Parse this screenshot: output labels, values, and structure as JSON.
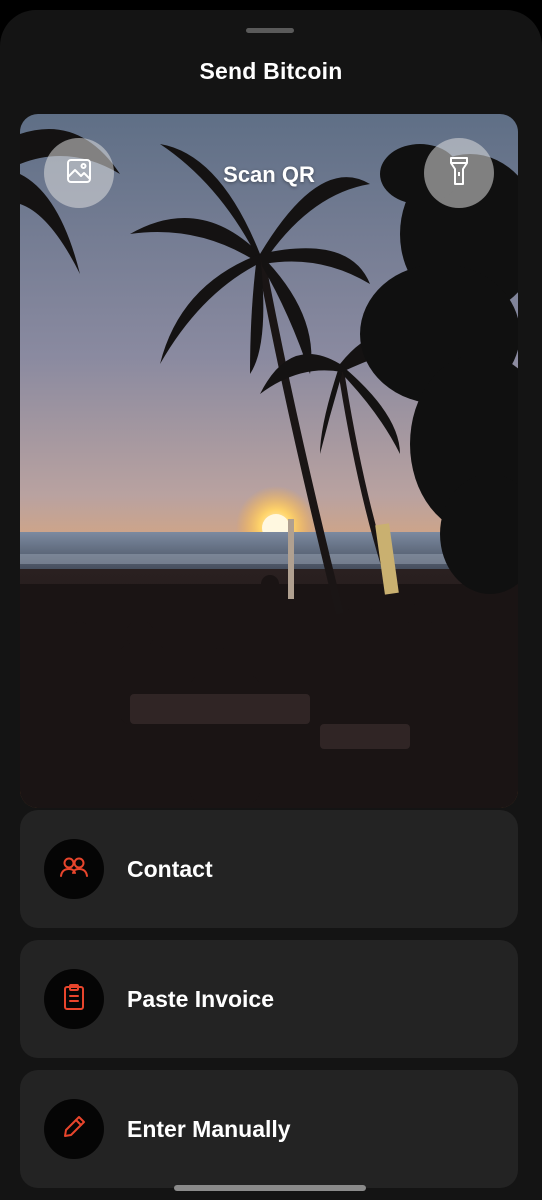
{
  "header": {
    "title": "Send Bitcoin"
  },
  "scanner": {
    "title": "Scan QR",
    "gallery_icon": "image-icon",
    "flashlight_icon": "flashlight-icon"
  },
  "actions": [
    {
      "label": "Contact",
      "icon": "contacts-icon"
    },
    {
      "label": "Paste Invoice",
      "icon": "clipboard-icon"
    },
    {
      "label": "Enter Manually",
      "icon": "pencil-icon"
    }
  ],
  "colors": {
    "accent": "#e8452c",
    "background": "#141414",
    "card": "#232323"
  }
}
